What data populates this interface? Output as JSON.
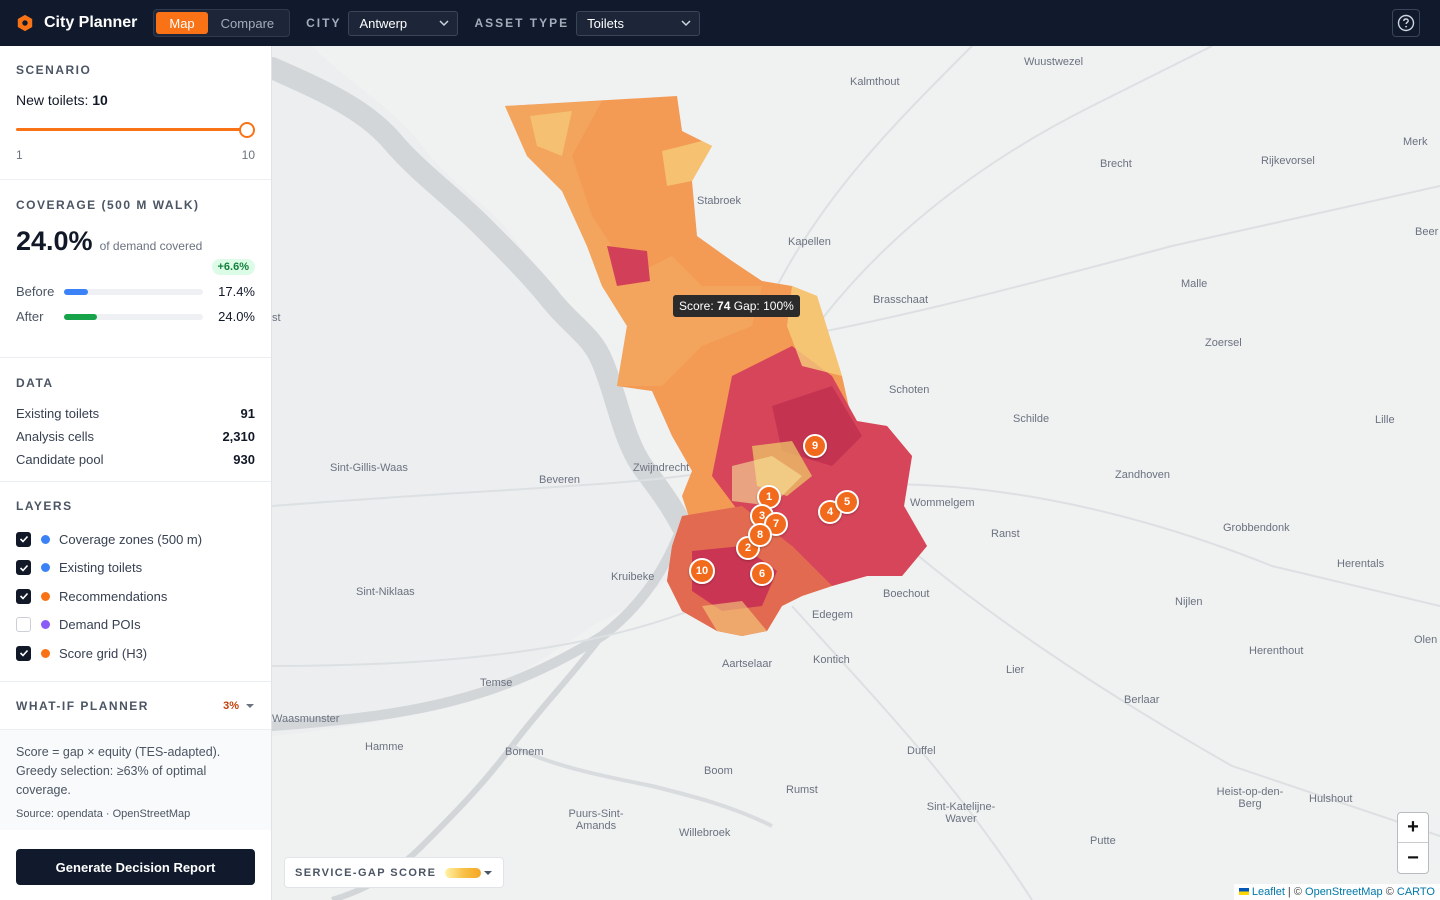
{
  "app": {
    "title": "City Planner"
  },
  "mode_tabs": [
    {
      "label": "Map"
    },
    {
      "label": "Compare"
    }
  ],
  "filters": {
    "city": {
      "label": "CITY",
      "value": "Antwerp"
    },
    "asset": {
      "label": "ASSET TYPE",
      "value": "Toilets"
    }
  },
  "scenario": {
    "title": "SCENARIO",
    "label": "New toilets:",
    "value": "10",
    "min": "1",
    "max": "10",
    "slider_fraction": 1.0
  },
  "coverage": {
    "title": "COVERAGE (500 M WALK)",
    "value": "24.0%",
    "caption": "of demand covered",
    "delta": "+6.6%",
    "before_label": "Before",
    "before_value": "17.4%",
    "before_fraction": 0.174,
    "after_label": "After",
    "after_value": "24.0%",
    "after_fraction": 0.24
  },
  "data": {
    "title": "DATA",
    "rows": [
      {
        "label": "Existing toilets",
        "value": "91"
      },
      {
        "label": "Analysis cells",
        "value": "2,310"
      },
      {
        "label": "Candidate pool",
        "value": "930"
      }
    ]
  },
  "layers": {
    "title": "LAYERS",
    "items": [
      {
        "label": "Coverage zones (500 m)",
        "checked": true,
        "color": "#3b82f6"
      },
      {
        "label": "Existing toilets",
        "checked": true,
        "color": "#3b82f6"
      },
      {
        "label": "Recommendations",
        "checked": true,
        "color": "#f97316"
      },
      {
        "label": "Demand POIs",
        "checked": false,
        "color": "#8b5cf6"
      },
      {
        "label": "Score grid (H3)",
        "checked": true,
        "color": "#f97316"
      }
    ]
  },
  "whatif": {
    "title": "WHAT-IF PLANNER",
    "badge": "3%"
  },
  "info": {
    "line1": "Score = gap × equity (TES-adapted).",
    "line2": "Greedy selection: ≥63% of optimal",
    "line3": "coverage.",
    "source": "Source: opendata · OpenStreetMap"
  },
  "report_button": "Generate Decision Report",
  "map": {
    "tooltip": {
      "score_label": "Score:",
      "score": "74",
      "gap_label": "Gap:",
      "gap": "100%"
    },
    "legend_label": "SERVICE-GAP SCORE",
    "zoom_in": "+",
    "zoom_out": "−",
    "attribution": {
      "leaflet": "Leaflet",
      "sep1": " | © ",
      "osm": "OpenStreetMap",
      "sep2": " © ",
      "carto": "CARTO"
    },
    "places": [
      "Wuustwezel",
      "Kalmthout",
      "Merk",
      "Brecht",
      "Rijkevorsel",
      "Beer",
      "Stabroek",
      "Kapellen",
      "Malle",
      "Brasschaat",
      "Zoersel",
      "Schoten",
      "Schilde",
      "Lille",
      "Zandhoven",
      "Sint-Gillis-Waas",
      "Zwijndrecht",
      "Beveren",
      "Wommelgem",
      "Ranst",
      "Grobbendonk",
      "Herentals",
      "Kruibeke",
      "Sint-Niklaas",
      "Boechout",
      "Nijlen",
      "Edegem",
      "Olen",
      "Kontich",
      "Aartselaar",
      "Lier",
      "Herenthout",
      "Temse",
      "Berlaar",
      "Waasmunster",
      "Hamme",
      "Bornem",
      "Duffel",
      "Boom",
      "Rumst",
      "Heist-op-den-Berg",
      "Hulshout",
      "Puurs-Sint-Amands",
      "Sint-Katelijne-Waver",
      "Willebroek",
      "Putte",
      "st"
    ],
    "markers": [
      "1",
      "2",
      "3",
      "4",
      "5",
      "6",
      "7",
      "8",
      "9",
      "10"
    ]
  }
}
